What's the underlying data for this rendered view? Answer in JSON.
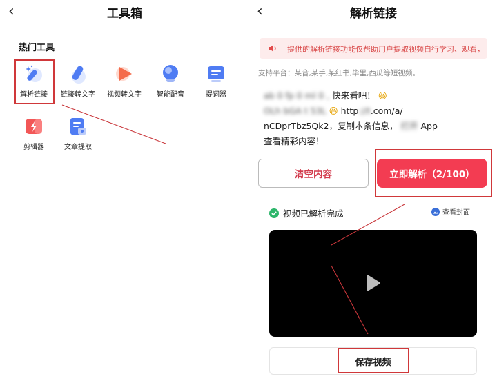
{
  "left_screen": {
    "title": "工具箱",
    "section_title": "热门工具",
    "tools": [
      {
        "label": "解析链接",
        "icon": "magic-wand-icon"
      },
      {
        "label": "链接转文字",
        "icon": "text-bubble-icon"
      },
      {
        "label": "视频转文字",
        "icon": "play-icon"
      },
      {
        "label": "智能配音",
        "icon": "microphone-icon"
      },
      {
        "label": "提词器",
        "icon": "teleprompter-icon"
      },
      {
        "label": "剪辑器",
        "icon": "scissors-icon"
      },
      {
        "label": "文章提取",
        "icon": "document-extract-icon"
      }
    ]
  },
  "right_screen": {
    "title": "解析链接",
    "notice": "提供的解析链接功能仅帮助用户提取视频自行学习、观看，",
    "platforms": "支持平台：某音,某手,某红书,毕里,西瓜等短视频。",
    "link_text": {
      "line1_blur": "ab 0 fp 0 ml 0 ,",
      "line1_tail": "快来看吧！",
      "line2_blur": "OLh bGA t 53L",
      "line2_mid": "http",
      "line2_blur2": "://t",
      "line2_tail": ".com/a/",
      "line3_start": "nCDprTbz5Qk2，复制本条信息，",
      "line3_blur": "打开",
      "line3_tail": "App",
      "line4": "查看精彩内容！"
    },
    "clear_button": "清空内容",
    "parse_button": "立即解析（2/100）",
    "status_text": "视频已解析完成",
    "cover_link": "查看封面",
    "save_button": "保存视频"
  },
  "colors": {
    "accent_red": "#f33c52",
    "highlight_red": "#d0383a",
    "notice_bg": "#fdecec",
    "success_green": "#2db66b",
    "cover_blue": "#3a6fd8"
  }
}
